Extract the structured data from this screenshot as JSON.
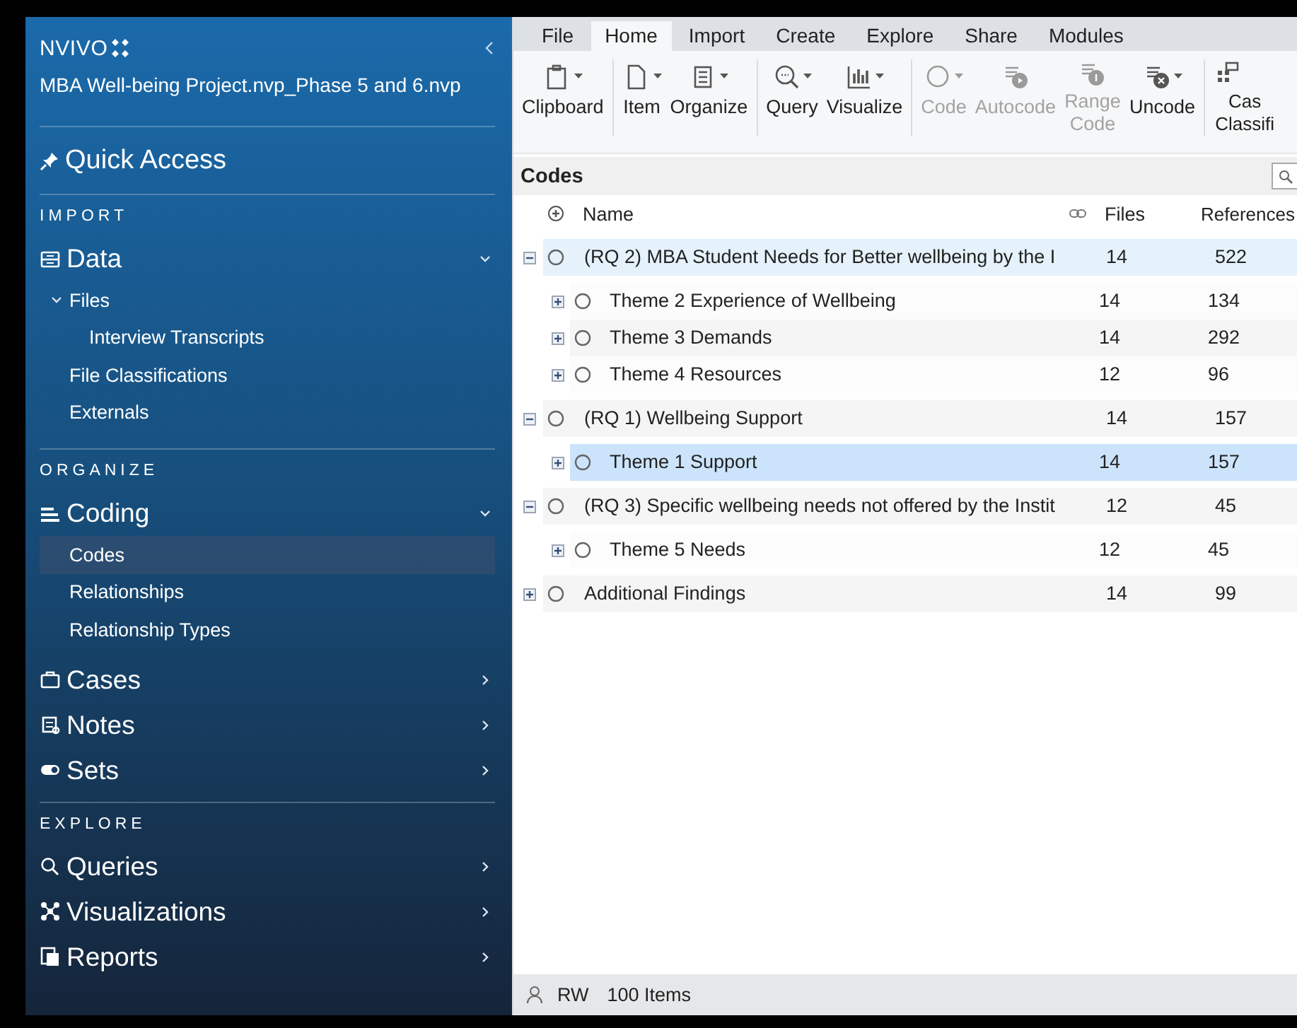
{
  "sidebar": {
    "logo": "NVIVO",
    "project": "MBA Well-being Project.nvp_Phase 5 and 6.nvp",
    "sections": [
      {
        "kind": "quick",
        "label": "Quick Access"
      },
      {
        "kind": "heading",
        "label": "IMPORT"
      },
      {
        "kind": "group",
        "label": "Data",
        "expanded": true,
        "children": [
          {
            "label": "Files",
            "selected": false,
            "expanded": true,
            "children": [
              {
                "label": "Interview Transcripts",
                "selected": false
              }
            ]
          },
          {
            "label": "File Classifications",
            "selected": false
          },
          {
            "label": "Externals",
            "selected": false
          }
        ]
      },
      {
        "kind": "heading",
        "label": "ORGANIZE"
      },
      {
        "kind": "group",
        "label": "Coding",
        "expanded": true,
        "children": [
          {
            "label": "Codes",
            "selected": true
          },
          {
            "label": "Relationships",
            "selected": false
          },
          {
            "label": "Relationship Types",
            "selected": false
          }
        ]
      },
      {
        "kind": "group",
        "label": "Cases",
        "expanded": false
      },
      {
        "kind": "group",
        "label": "Notes",
        "expanded": false
      },
      {
        "kind": "group",
        "label": "Sets",
        "expanded": false
      },
      {
        "kind": "heading",
        "label": "EXPLORE"
      },
      {
        "kind": "group",
        "label": "Queries",
        "expanded": false
      },
      {
        "kind": "group",
        "label": "Visualizations",
        "expanded": false
      },
      {
        "kind": "group",
        "label": "Reports",
        "expanded": false
      }
    ]
  },
  "tabs": [
    {
      "label": "File",
      "selected": false
    },
    {
      "label": "Home",
      "selected": true
    },
    {
      "label": "Import",
      "selected": false
    },
    {
      "label": "Create",
      "selected": false
    },
    {
      "label": "Explore",
      "selected": false
    },
    {
      "label": "Share",
      "selected": false
    },
    {
      "label": "Modules",
      "selected": false
    }
  ],
  "ribbon": [
    {
      "buttons": [
        {
          "label": "Clipboard",
          "disabled": false,
          "menu": true
        }
      ]
    },
    {
      "buttons": [
        {
          "label": "Item",
          "disabled": false,
          "menu": true
        },
        {
          "label": "Organize",
          "disabled": false,
          "menu": true
        }
      ]
    },
    {
      "buttons": [
        {
          "label": "Query",
          "disabled": false,
          "menu": true
        },
        {
          "label": "Visualize",
          "disabled": false,
          "menu": true
        }
      ]
    },
    {
      "buttons": [
        {
          "label": "Code",
          "disabled": true,
          "menu": true
        },
        {
          "label": "Autocode",
          "disabled": true,
          "menu": false
        },
        {
          "label": "Range Code",
          "disabled": true,
          "menu": false
        },
        {
          "label": "Uncode",
          "disabled": false,
          "menu": true
        }
      ]
    },
    {
      "buttons": [
        {
          "label": "Cas Classifi",
          "disabled": false,
          "menu": false
        }
      ]
    }
  ],
  "panel": {
    "title": "Codes"
  },
  "table": {
    "columns": [
      "Name",
      "Files",
      "References"
    ],
    "rows": [
      {
        "name": "(RQ 2) MBA Student Needs for Better wellbeing by the I",
        "files": "14",
        "references": "522",
        "expanded": true,
        "selected": false,
        "hovered": true,
        "children": [
          {
            "name": "Theme 2 Experience of Wellbeing",
            "files": "14",
            "references": "134",
            "expanded": false,
            "selected": false,
            "hovered": false
          },
          {
            "name": "Theme 3 Demands",
            "files": "14",
            "references": "292",
            "expanded": false,
            "selected": false,
            "hovered": false
          },
          {
            "name": "Theme 4 Resources",
            "files": "12",
            "references": "96",
            "expanded": false,
            "selected": false,
            "hovered": false
          }
        ]
      },
      {
        "name": "(RQ 1) Wellbeing Support",
        "files": "14",
        "references": "157",
        "expanded": true,
        "selected": false,
        "hovered": false,
        "children": [
          {
            "name": "Theme 1 Support",
            "files": "14",
            "references": "157",
            "expanded": false,
            "selected": true,
            "hovered": false
          }
        ]
      },
      {
        "name": "(RQ 3) Specific wellbeing needs not offered by the Instit",
        "files": "12",
        "references": "45",
        "expanded": true,
        "selected": false,
        "hovered": false,
        "children": [
          {
            "name": "Theme 5 Needs",
            "files": "12",
            "references": "45",
            "expanded": false,
            "selected": false,
            "hovered": false
          }
        ]
      },
      {
        "name": "Additional Findings",
        "files": "14",
        "references": "99",
        "expanded": false,
        "selected": false,
        "hovered": false
      }
    ]
  },
  "status_bar": {
    "user": "RW",
    "count": "100 Items"
  }
}
